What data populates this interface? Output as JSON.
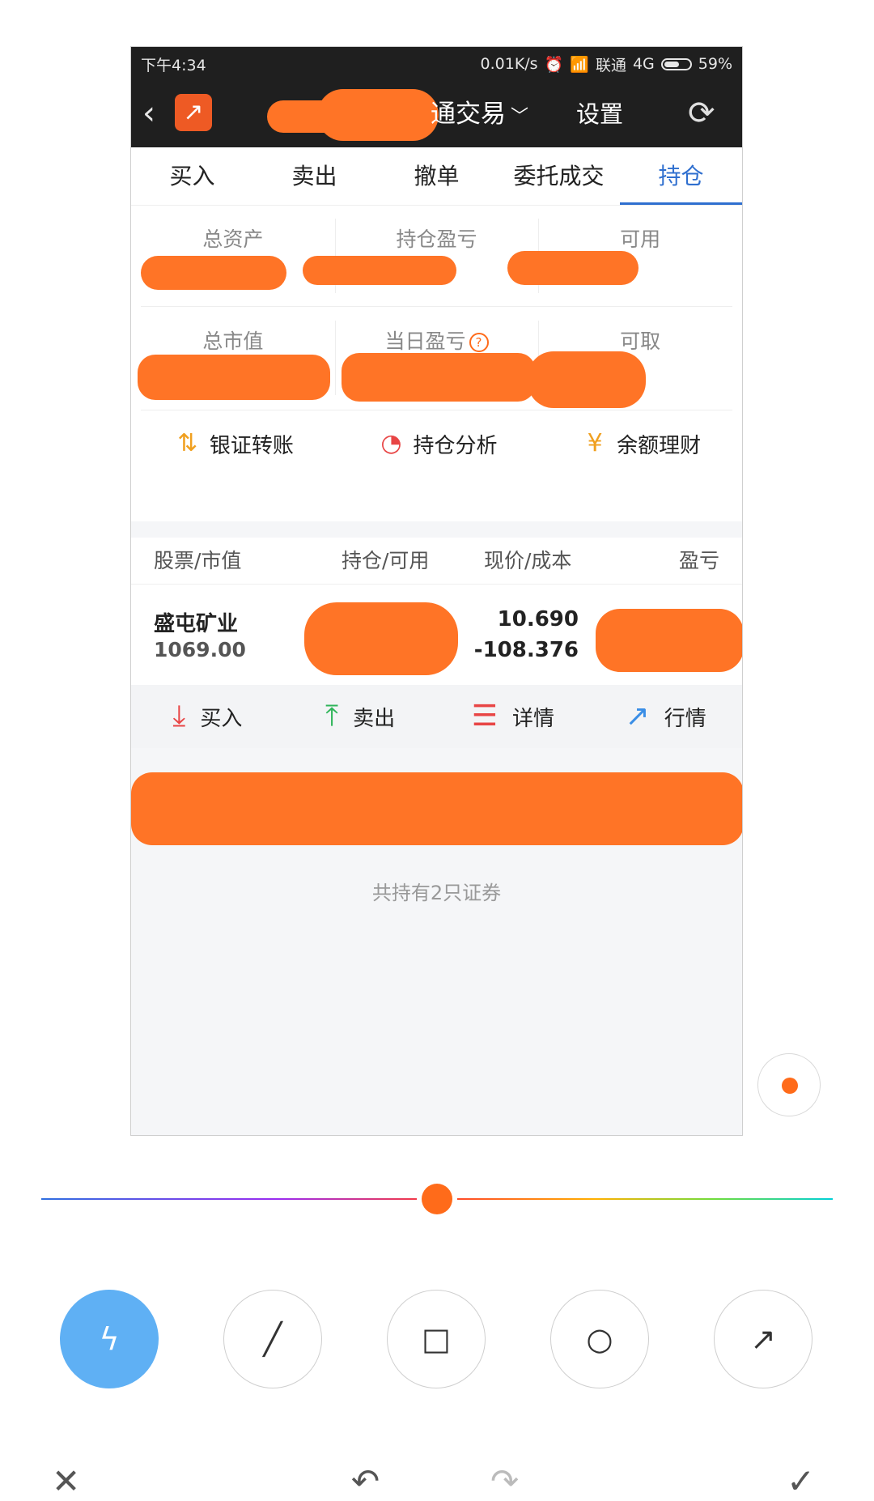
{
  "status_bar": {
    "time": "下午4:34",
    "net_speed": "0.01K/s",
    "carrier": "联通",
    "network": "4G",
    "battery": "59%"
  },
  "nav": {
    "title": "通交易",
    "settings": "设置"
  },
  "tabs": [
    "买入",
    "卖出",
    "撤单",
    "委托成交",
    "持仓"
  ],
  "summary": {
    "row1": [
      "总资产",
      "持仓盈亏",
      "可用"
    ],
    "row2": [
      "总市值",
      "当日盈亏",
      "可取"
    ]
  },
  "quick_links": [
    "银证转账",
    "持仓分析",
    "余额理财"
  ],
  "table_headers": [
    "股票/市值",
    "持仓/可用",
    "现价/成本",
    "盈亏"
  ],
  "stock": {
    "name": "盛屯矿业",
    "market_value": "1069.00",
    "price": "10.690",
    "cost": "-108.376"
  },
  "actions": [
    "买入",
    "卖出",
    "详情",
    "行情"
  ],
  "footer_note": "共持有2只证券",
  "colors": {
    "active_tab": "#2f6fcf",
    "redaction": "#ff7426",
    "selected_tool": "#5fb0f4",
    "slider_thumb": "#ff6b1a"
  },
  "icons": {
    "tools": [
      "pen-icon",
      "line-icon",
      "rectangle-icon",
      "circle-icon",
      "arrow-icon"
    ],
    "bottom": [
      "close-icon",
      "undo-icon",
      "redo-icon",
      "confirm-icon"
    ]
  }
}
